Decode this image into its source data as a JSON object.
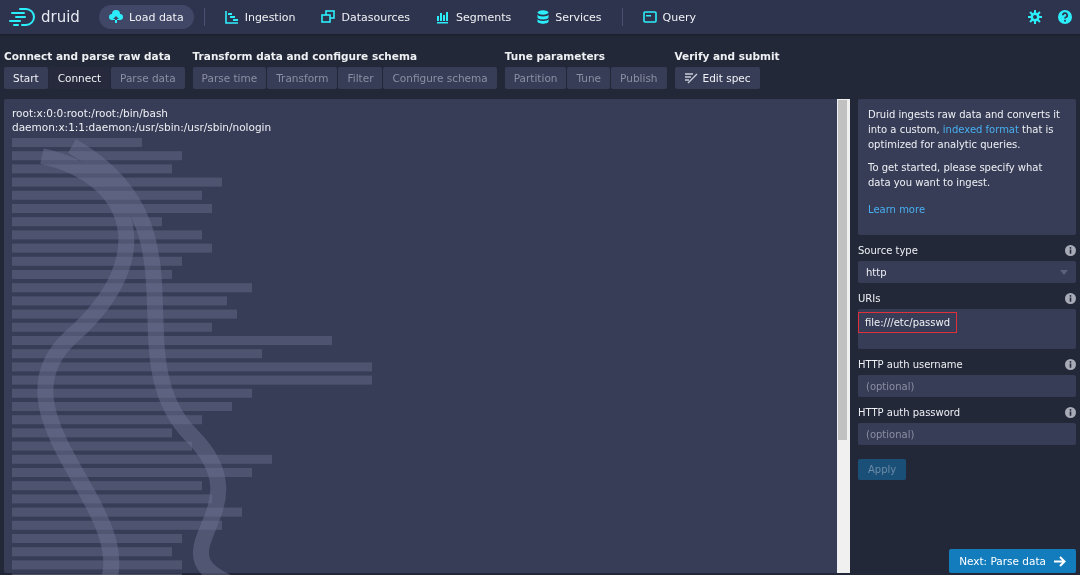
{
  "nav": {
    "logo": "druid",
    "items": [
      {
        "label": "Load data",
        "kind": "upload",
        "selected": true
      },
      {
        "label": "Ingestion",
        "kind": "gantt",
        "selected": false
      },
      {
        "label": "Datasources",
        "kind": "windows",
        "selected": false
      },
      {
        "label": "Segments",
        "kind": "bars",
        "selected": false
      },
      {
        "label": "Services",
        "kind": "database",
        "selected": false
      },
      {
        "label": "Query",
        "kind": "console",
        "selected": false
      }
    ]
  },
  "steps": [
    {
      "title": "Connect and parse raw data",
      "tabs": [
        {
          "label": "Start",
          "selected": false,
          "disabled": false
        },
        {
          "label": "Connect",
          "selected": true,
          "disabled": false
        },
        {
          "label": "Parse data",
          "selected": false,
          "disabled": true
        }
      ]
    },
    {
      "title": "Transform data and configure schema",
      "tabs": [
        {
          "label": "Parse time",
          "selected": false,
          "disabled": true
        },
        {
          "label": "Transform",
          "selected": false,
          "disabled": true
        },
        {
          "label": "Filter",
          "selected": false,
          "disabled": true
        },
        {
          "label": "Configure schema",
          "selected": false,
          "disabled": true
        }
      ]
    },
    {
      "title": "Tune parameters",
      "tabs": [
        {
          "label": "Partition",
          "selected": false,
          "disabled": true
        },
        {
          "label": "Tune",
          "selected": false,
          "disabled": true
        },
        {
          "label": "Publish",
          "selected": false,
          "disabled": true
        }
      ]
    },
    {
      "title": "Verify and submit",
      "tabs": [
        {
          "label": "Edit spec",
          "selected": false,
          "disabled": false,
          "kind": "edit"
        }
      ]
    }
  ],
  "preview": {
    "lines": [
      "root:x:0:0:root:/root:/bin/bash",
      "daemon:x:1:1:daemon:/usr/sbin:/usr/sbin/nologin"
    ]
  },
  "info": {
    "text_before": "Druid ingests raw data and converts it into a custom, ",
    "link": "indexed format",
    "text_after": " that is optimized for analytic queries.",
    "paragraph": "To get started, please specify what data you want to ingest.",
    "learn_more": "Learn more"
  },
  "form": [
    {
      "kind": "select",
      "label": "Source type",
      "value": "http"
    },
    {
      "kind": "textarea",
      "label": "URIs",
      "value": "file:///etc/passwd",
      "highlighted": true
    },
    {
      "kind": "input",
      "label": "HTTP auth username",
      "placeholder": "(optional)"
    },
    {
      "kind": "input",
      "label": "HTTP auth password",
      "placeholder": "(optional)"
    }
  ],
  "apply_button": {
    "label": "Apply",
    "disabled": true
  },
  "next_button": "Next: Parse data"
}
